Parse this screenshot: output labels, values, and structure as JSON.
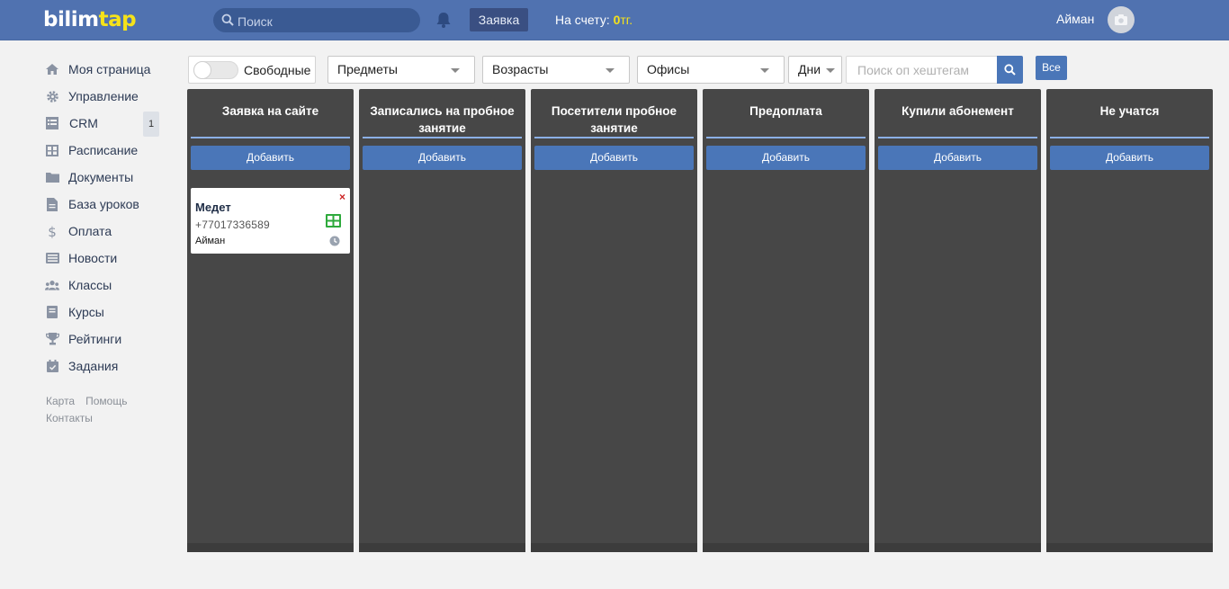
{
  "header": {
    "logo_part1": "bilim",
    "logo_part2": "tap",
    "search_placeholder": "Поиск",
    "request_button": "Заявка",
    "balance_label": "На счету:",
    "balance_value": "0",
    "balance_currency": "тг.",
    "user_name": "Айман"
  },
  "sidebar": {
    "items": [
      {
        "label": "Моя страница",
        "icon": "home-icon"
      },
      {
        "label": "Управление",
        "icon": "gear-icon"
      },
      {
        "label": "CRM",
        "icon": "list-icon",
        "badge": "1"
      },
      {
        "label": "Расписание",
        "icon": "table-icon"
      },
      {
        "label": "Документы",
        "icon": "folder-icon"
      },
      {
        "label": "База уроков",
        "icon": "file-icon"
      },
      {
        "label": "Оплата",
        "icon": "dollar-icon"
      },
      {
        "label": "Новости",
        "icon": "news-icon"
      },
      {
        "label": "Классы",
        "icon": "users-icon"
      },
      {
        "label": "Курсы",
        "icon": "book-icon"
      },
      {
        "label": "Рейтинги",
        "icon": "trophy-icon"
      },
      {
        "label": "Задания",
        "icon": "calendar-check-icon"
      }
    ],
    "footer": {
      "map": "Карта",
      "help": "Помощь",
      "contacts": "Контакты"
    }
  },
  "filters": {
    "free_toggle_label": "Свободные",
    "free_toggle_on": false,
    "subjects": "Предметы",
    "ages": "Возрасты",
    "offices": "Офисы",
    "days": "Дни",
    "hashtag_placeholder": "Поиск оп хештегам",
    "all_button": "Все"
  },
  "board": {
    "add_label": "Добавить",
    "columns": [
      {
        "title": "Заявка на сайте"
      },
      {
        "title": "Записались на пробное занятие"
      },
      {
        "title": "Посетители пробное занятие"
      },
      {
        "title": "Предоплата"
      },
      {
        "title": "Купили абонемент"
      },
      {
        "title": "Не учатся"
      }
    ],
    "cards": [
      {
        "name": "Медет",
        "phone": "+77017336589",
        "owner": "Айман",
        "close": "×"
      }
    ]
  },
  "colors": {
    "header_bg": "#5072b0",
    "logo_accent": "#f5e21a",
    "button_blue": "#4a76b8",
    "column_bg": "#474747",
    "column_line": "#8bb0e6",
    "close_red": "#cc2222",
    "table_icon_green": "#2eaa3c"
  }
}
